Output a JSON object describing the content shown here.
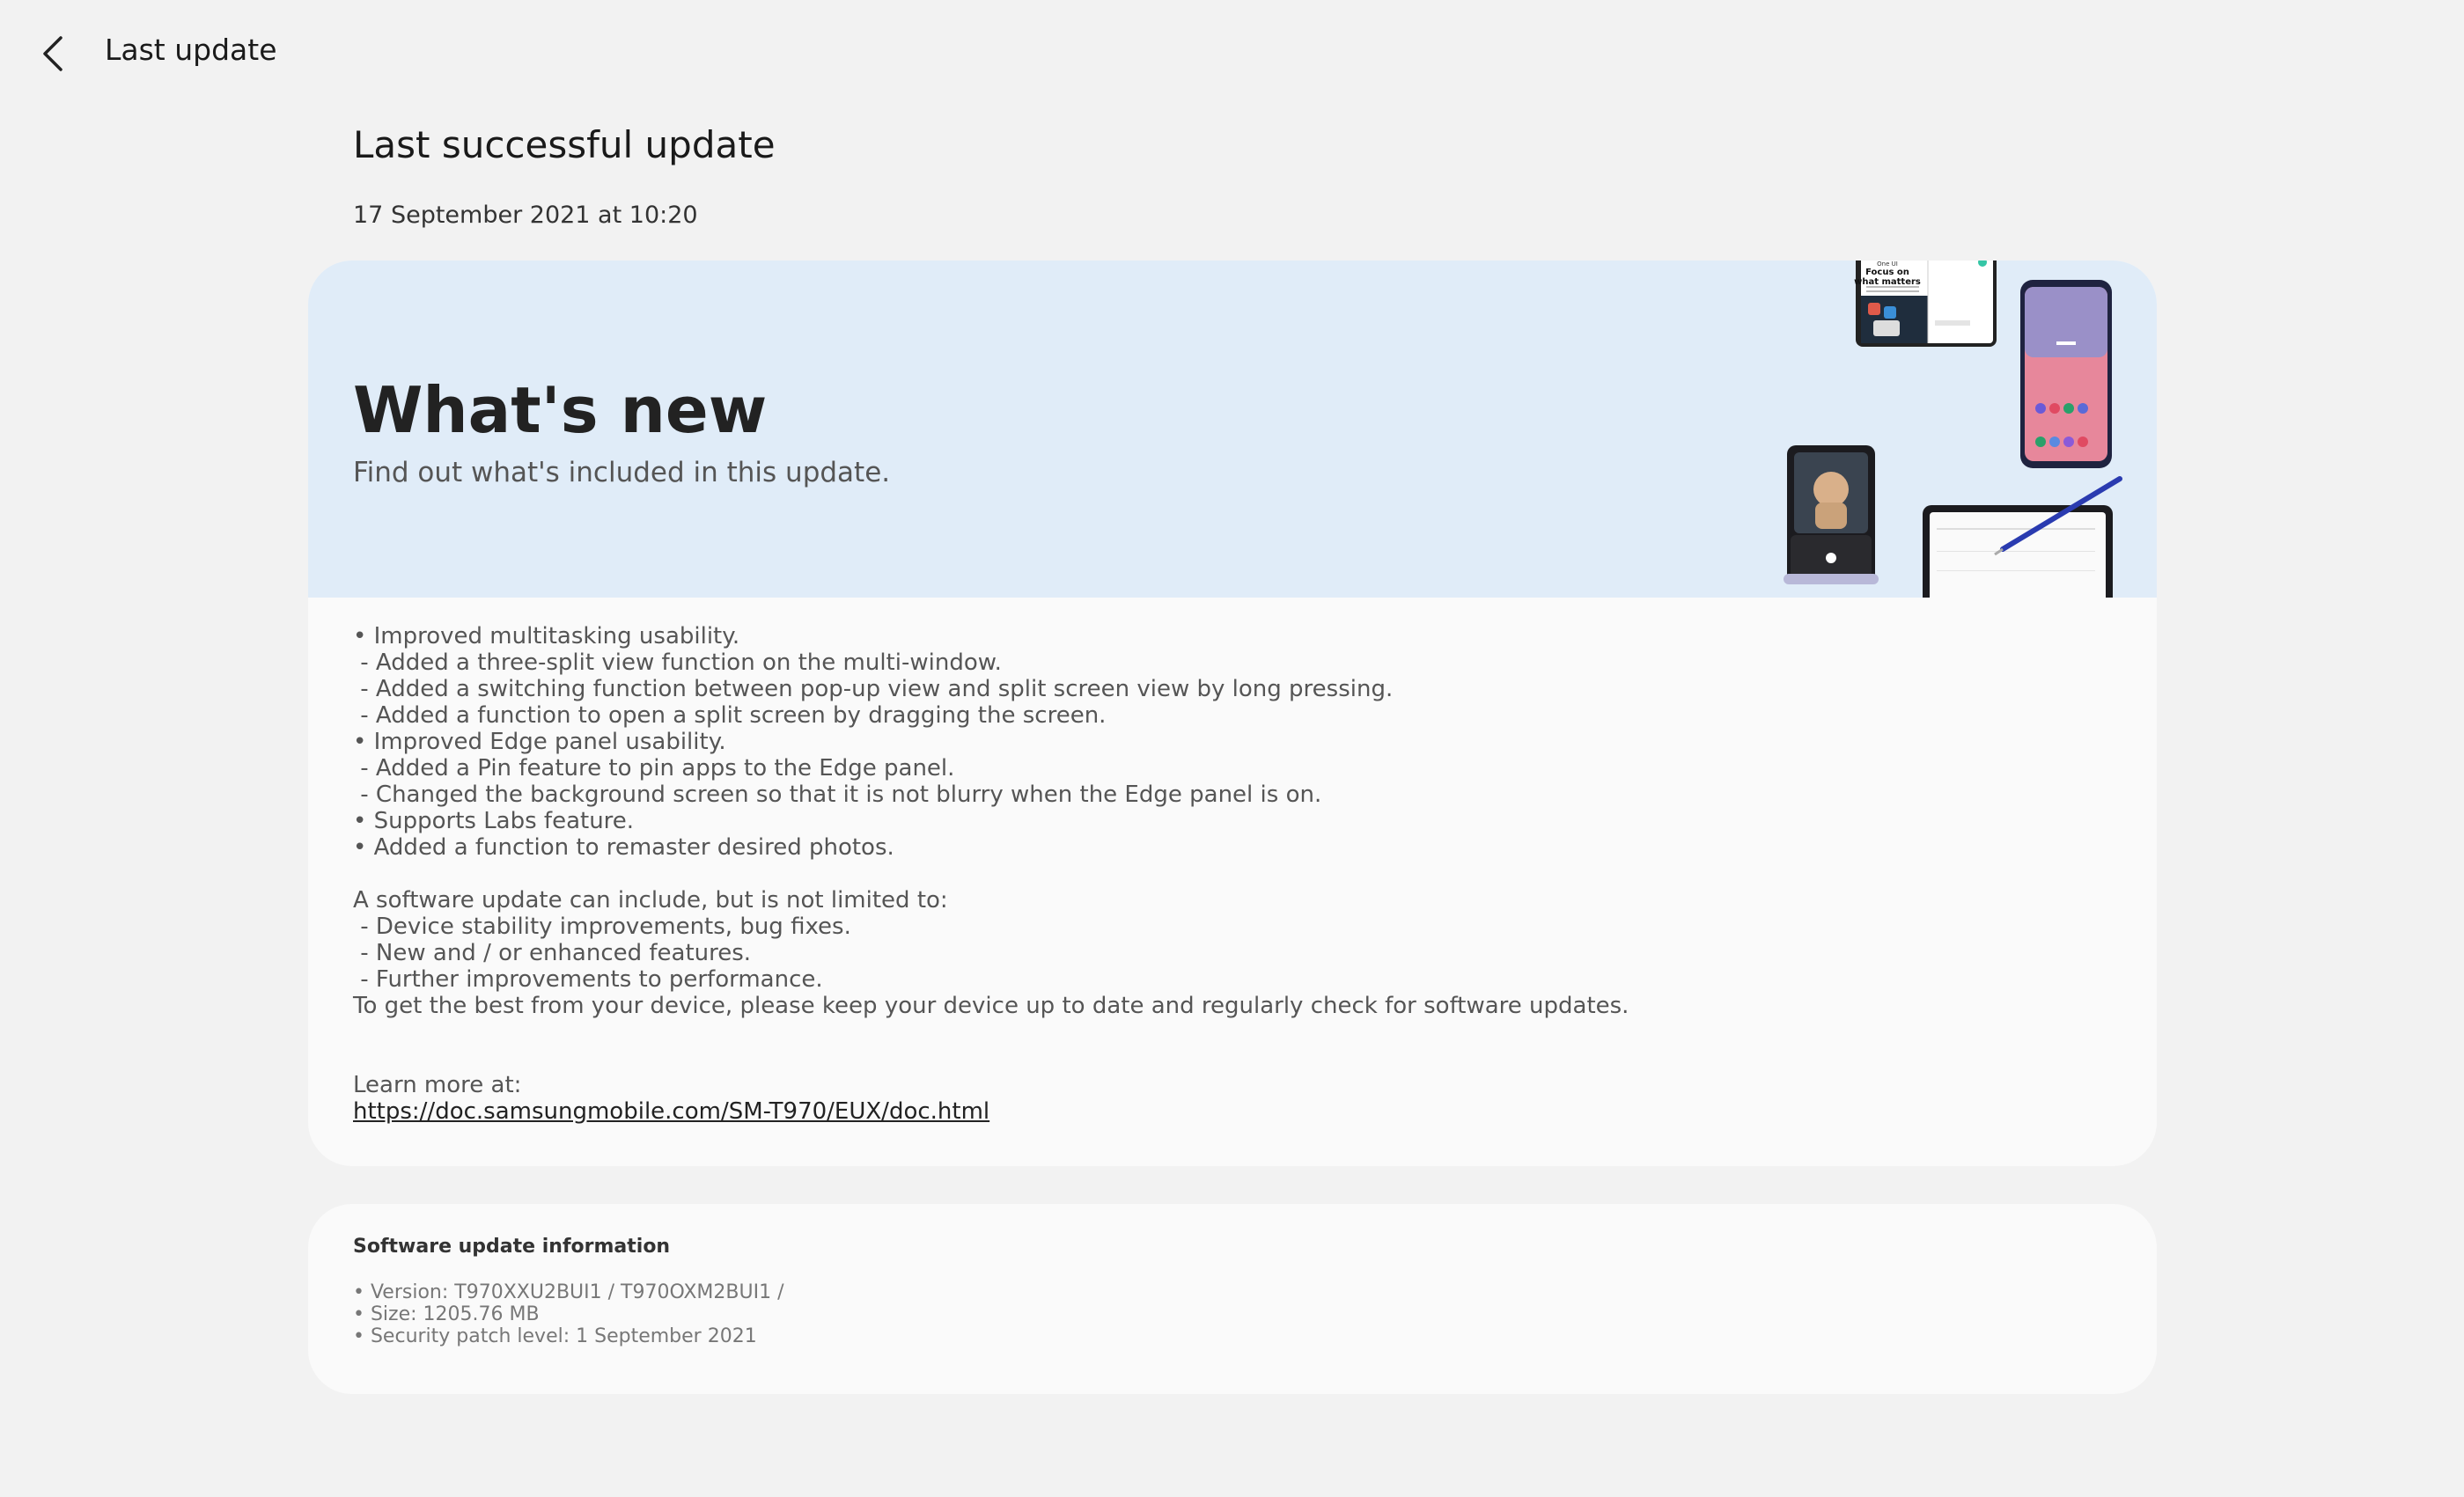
{
  "header": {
    "title": "Last update",
    "back_icon": "chevron-left-icon"
  },
  "last_update": {
    "title": "Last successful update",
    "date": "17 September 2021 at 10:20"
  },
  "whats_new": {
    "title": "What's new",
    "subtitle": "Find out what's included in this update.",
    "banner_color": "#e0ecf8",
    "banner_mini_text": [
      "One UI",
      "Focus on",
      "what matters"
    ],
    "notes": [
      "• Improved multitasking usability.",
      " - Added a three-split view function on the multi-window.",
      " - Added a switching function between pop-up view and split screen view by long pressing.",
      " - Added a function to open a split screen by dragging the screen.",
      "• Improved Edge panel usability.",
      " - Added a Pin feature to pin apps to the Edge panel.",
      " - Changed the background screen so that it is not blurry when the Edge panel is on.",
      "• Supports Labs feature.",
      "• Added a function to remaster desired photos."
    ],
    "general": [
      "A software update can include, but is not limited to:",
      " - Device stability improvements, bug fixes.",
      " - New and / or enhanced features.",
      " - Further improvements to performance.",
      "To get the best from your device, please keep your device up to date and regularly check for software updates."
    ],
    "learn_more_label": "Learn more at:",
    "learn_more_link": "https://doc.samsungmobile.com/SM-T970/EUX/doc.html"
  },
  "software_info": {
    "title": "Software update information",
    "items": [
      "• Version: T970XXU2BUI1 / T970OXM2BUI1 /",
      "• Size: 1205.76 MB",
      "• Security patch level: 1 September 2021"
    ]
  },
  "colors": {
    "background": "#f2f2f2",
    "card": "#fafafa",
    "banner": "#e0ecf8"
  }
}
